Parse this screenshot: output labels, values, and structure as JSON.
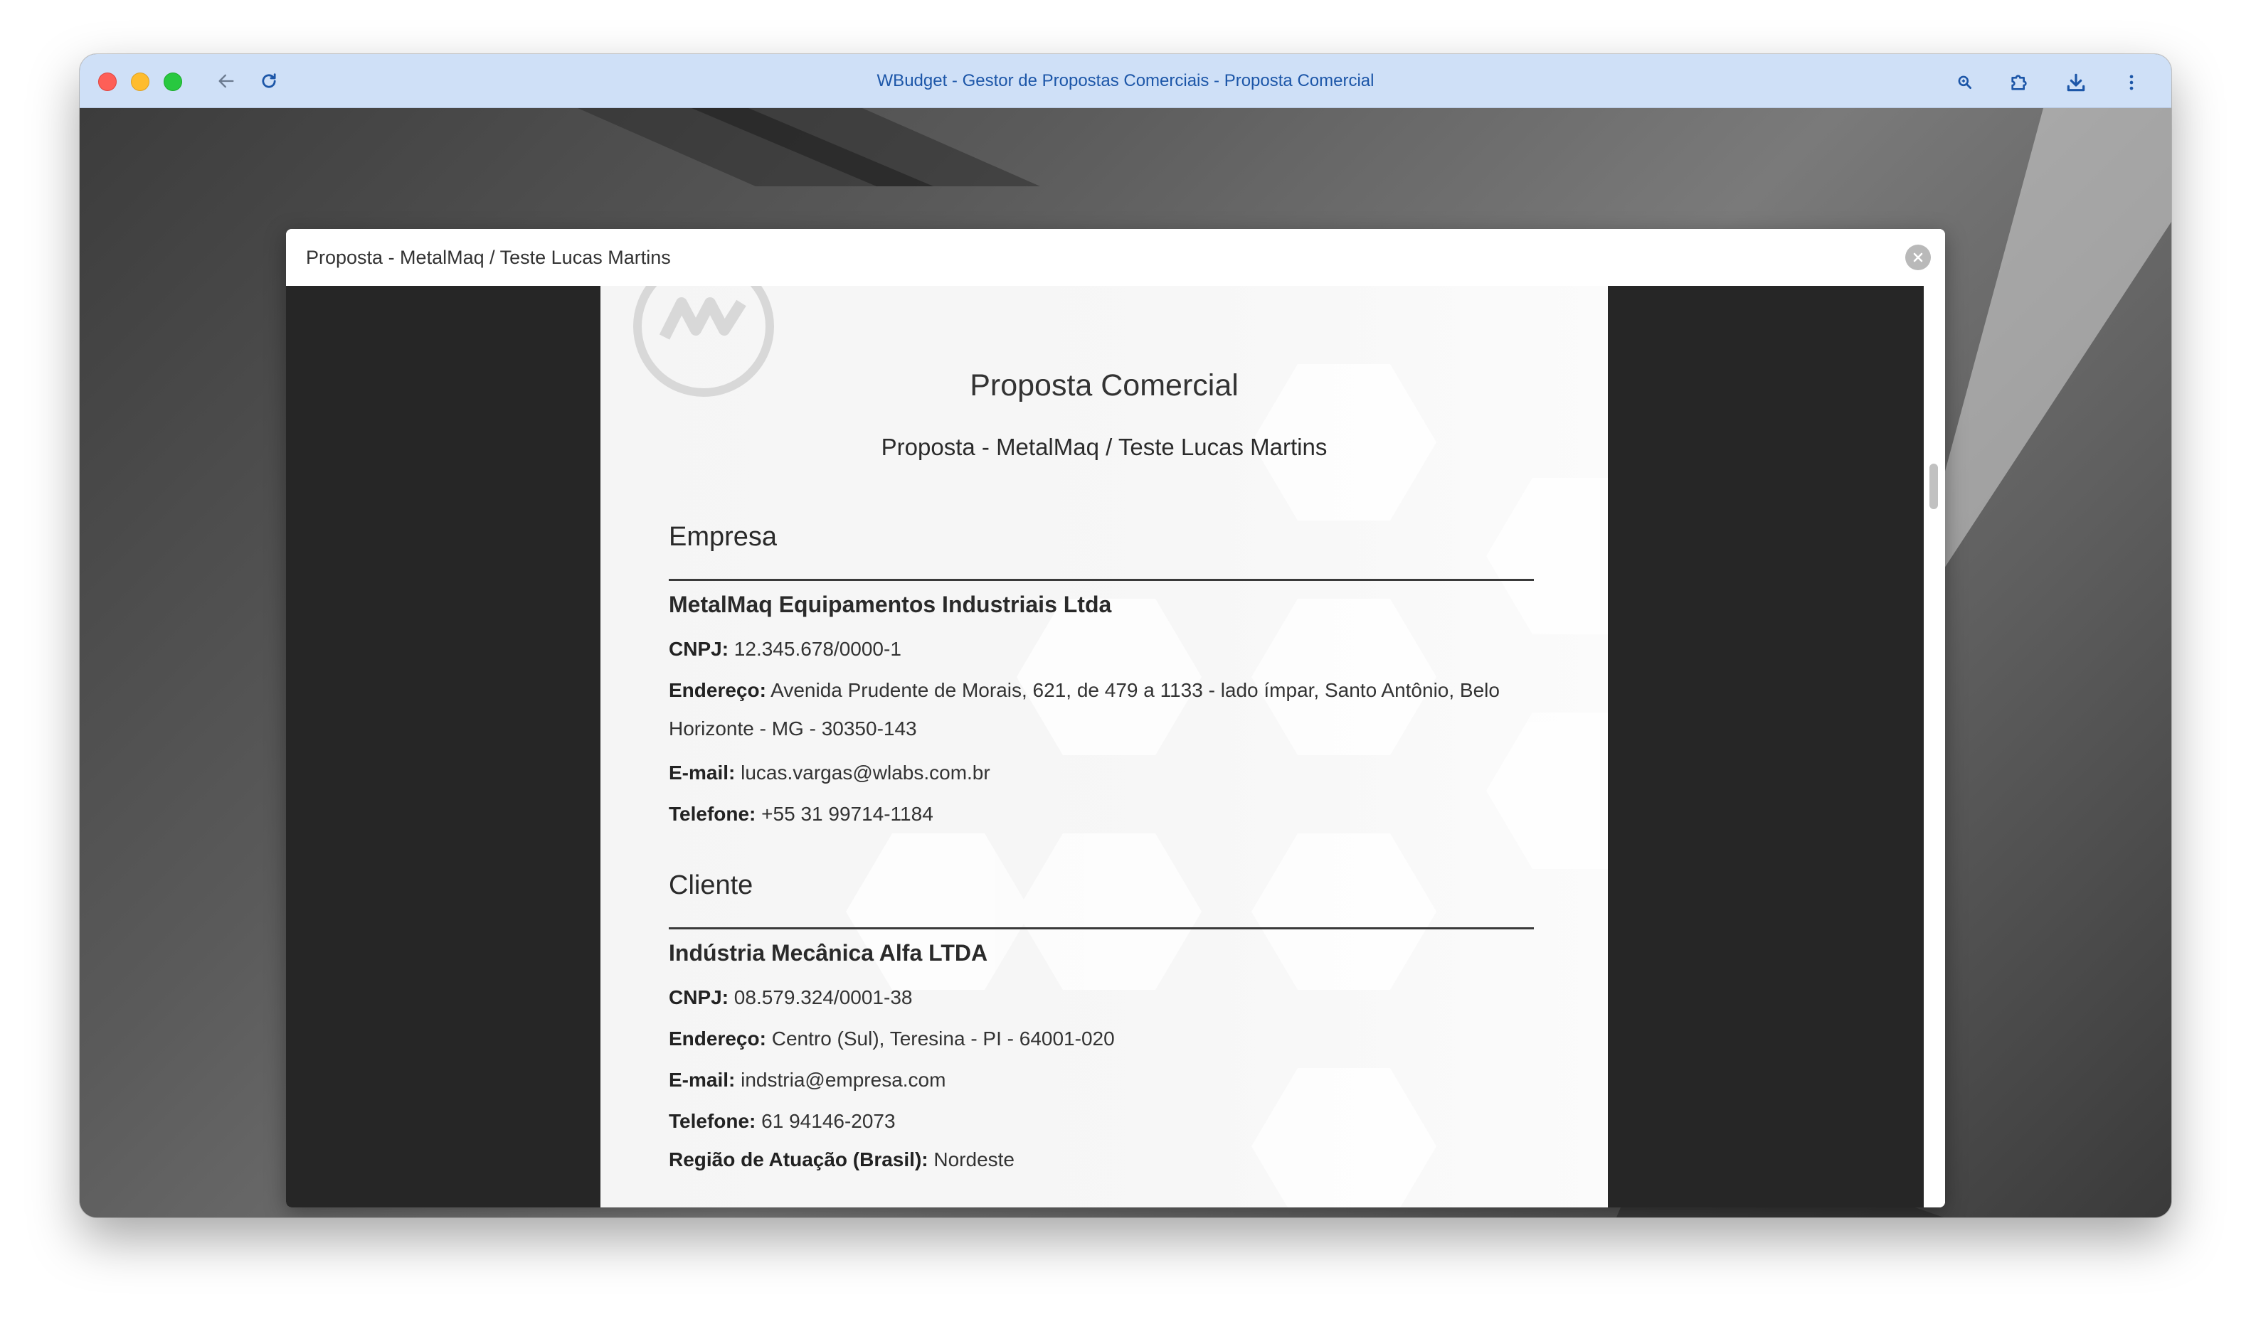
{
  "window": {
    "title": "WBudget - Gestor de Propostas Comerciais - Proposta Comercial"
  },
  "toolbar": {
    "back_icon": "arrow-left-icon",
    "reload_icon": "reload-icon",
    "zoom_icon": "magnifier-icon",
    "extensions_icon": "puzzle-icon",
    "download_icon": "download-icon",
    "menu_icon": "more-vertical-icon"
  },
  "modal": {
    "title": "Proposta - MetalMaq / Teste Lucas Martins",
    "close_icon": "close-circle-icon"
  },
  "document": {
    "title": "Proposta Comercial",
    "subtitle": "Proposta - MetalMaq / Teste Lucas Martins",
    "company": {
      "heading": "Empresa",
      "name": "MetalMaq Equipamentos Industriais Ltda",
      "cnpj_label": "CNPJ:",
      "cnpj": "12.345.678/0000-1",
      "address_label": "Endereço:",
      "address": "Avenida Prudente de Morais, 621, de 479 a 1133 - lado ímpar, Santo Antônio, Belo Horizonte - MG - 30350-143",
      "email_label": "E-mail:",
      "email": "lucas.vargas@wlabs.com.br",
      "phone_label": "Telefone:",
      "phone": "+55 31 99714-1184"
    },
    "client": {
      "heading": "Cliente",
      "name": "Indústria Mecânica Alfa LTDA",
      "cnpj_label": "CNPJ:",
      "cnpj": "08.579.324/0001-38",
      "address_label": "Endereço:",
      "address": "Centro (Sul), Teresina - PI - 64001-020",
      "email_label": "E-mail:",
      "email": "indstria@empresa.com",
      "phone_label": "Telefone:",
      "phone": "61 94146-2073",
      "region_label": "Região de Atuação (Brasil):",
      "region": "Nordeste"
    }
  },
  "colors": {
    "titlebar": "#cfe0f7",
    "title_text": "#1c56a8",
    "viewer_bg": "#262626",
    "page_bg": "#f6f6f6"
  }
}
